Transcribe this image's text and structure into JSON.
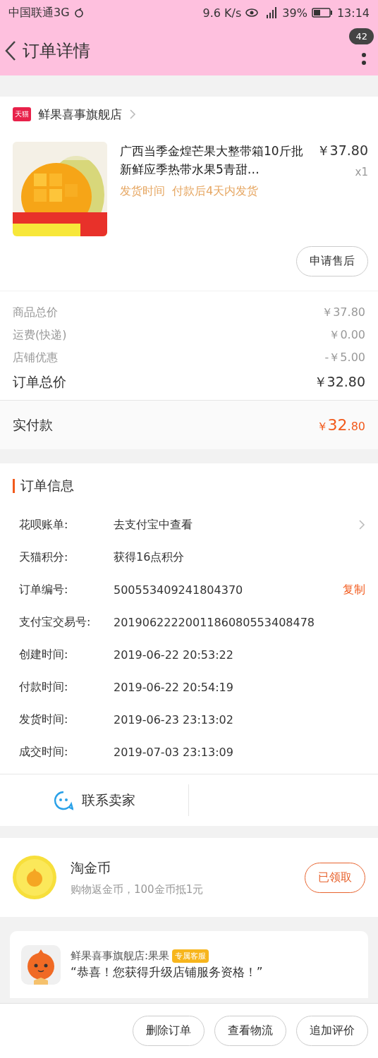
{
  "status_bar": {
    "carrier": "中国联通3G",
    "speed": "9.6 K/s",
    "battery": "39%",
    "time": "13:14"
  },
  "header": {
    "title": "订单详情",
    "badge": "42"
  },
  "shop": {
    "badge": "天猫",
    "name": "鲜果喜事旗舰店"
  },
  "product": {
    "title": "广西当季金煌芒果大整带箱10斤批新鲜应季热带水果5青甜…",
    "shipping_label": "发货时间",
    "shipping_value": "付款后4天内发货",
    "price": "￥37.80",
    "quantity": "x1"
  },
  "after_sale_button": "申请售后",
  "price_rows": [
    {
      "label": "商品总价",
      "value": "￥37.80",
      "kind": "minor"
    },
    {
      "label": "运费(快递)",
      "value": "￥0.00",
      "kind": "minor"
    },
    {
      "label": "店铺优惠",
      "value": "-￥5.00",
      "kind": "minor"
    },
    {
      "label": "订单总价",
      "value": "￥32.80",
      "kind": "total"
    }
  ],
  "paid": {
    "label": "实付款",
    "currency": "￥",
    "integer": "32",
    "decimal": ".80"
  },
  "order_info": {
    "title": "订单信息",
    "rows": [
      {
        "label": "花呗账单:",
        "value": "去支付宝中查看",
        "kind": "link"
      },
      {
        "label": "天猫积分:",
        "value": "获得16点积分",
        "kind": "plain"
      },
      {
        "label": "订单编号:",
        "value": "500553409241804370",
        "kind": "copy",
        "action": "复制"
      },
      {
        "label": "支付宝交易号:",
        "value": "2019062222001186080553408478",
        "kind": "plain"
      },
      {
        "label": "创建时间:",
        "value": "2019-06-22 20:53:22",
        "kind": "plain"
      },
      {
        "label": "付款时间:",
        "value": "2019-06-22 20:54:19",
        "kind": "plain"
      },
      {
        "label": "发货时间:",
        "value": "2019-06-23 23:13:02",
        "kind": "plain"
      },
      {
        "label": "成交时间:",
        "value": "2019-07-03 23:13:09",
        "kind": "plain"
      }
    ]
  },
  "contact_button": "联系卖家",
  "coins": {
    "title": "淘金币",
    "subtitle": "购物返金币，100金币抵1元",
    "button": "已领取"
  },
  "service": {
    "sender": "鲜果喜事旗舰店:果果",
    "tag": "专属客服",
    "message": "“恭喜！您获得升级店铺服务资格！”"
  },
  "actions": [
    "删除订单",
    "查看物流",
    "追加评价"
  ]
}
